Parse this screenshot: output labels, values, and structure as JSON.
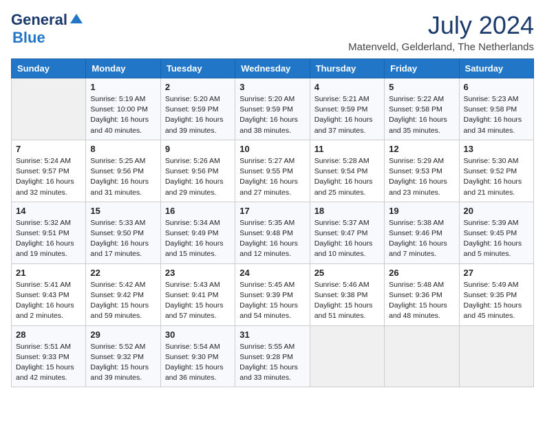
{
  "logo": {
    "line1": "General",
    "line2": "Blue"
  },
  "title": "July 2024",
  "location": "Matenveld, Gelderland, The Netherlands",
  "days_of_week": [
    "Sunday",
    "Monday",
    "Tuesday",
    "Wednesday",
    "Thursday",
    "Friday",
    "Saturday"
  ],
  "weeks": [
    [
      {
        "day": "",
        "content": ""
      },
      {
        "day": "1",
        "content": "Sunrise: 5:19 AM\nSunset: 10:00 PM\nDaylight: 16 hours\nand 40 minutes."
      },
      {
        "day": "2",
        "content": "Sunrise: 5:20 AM\nSunset: 9:59 PM\nDaylight: 16 hours\nand 39 minutes."
      },
      {
        "day": "3",
        "content": "Sunrise: 5:20 AM\nSunset: 9:59 PM\nDaylight: 16 hours\nand 38 minutes."
      },
      {
        "day": "4",
        "content": "Sunrise: 5:21 AM\nSunset: 9:59 PM\nDaylight: 16 hours\nand 37 minutes."
      },
      {
        "day": "5",
        "content": "Sunrise: 5:22 AM\nSunset: 9:58 PM\nDaylight: 16 hours\nand 35 minutes."
      },
      {
        "day": "6",
        "content": "Sunrise: 5:23 AM\nSunset: 9:58 PM\nDaylight: 16 hours\nand 34 minutes."
      }
    ],
    [
      {
        "day": "7",
        "content": "Sunrise: 5:24 AM\nSunset: 9:57 PM\nDaylight: 16 hours\nand 32 minutes."
      },
      {
        "day": "8",
        "content": "Sunrise: 5:25 AM\nSunset: 9:56 PM\nDaylight: 16 hours\nand 31 minutes."
      },
      {
        "day": "9",
        "content": "Sunrise: 5:26 AM\nSunset: 9:56 PM\nDaylight: 16 hours\nand 29 minutes."
      },
      {
        "day": "10",
        "content": "Sunrise: 5:27 AM\nSunset: 9:55 PM\nDaylight: 16 hours\nand 27 minutes."
      },
      {
        "day": "11",
        "content": "Sunrise: 5:28 AM\nSunset: 9:54 PM\nDaylight: 16 hours\nand 25 minutes."
      },
      {
        "day": "12",
        "content": "Sunrise: 5:29 AM\nSunset: 9:53 PM\nDaylight: 16 hours\nand 23 minutes."
      },
      {
        "day": "13",
        "content": "Sunrise: 5:30 AM\nSunset: 9:52 PM\nDaylight: 16 hours\nand 21 minutes."
      }
    ],
    [
      {
        "day": "14",
        "content": "Sunrise: 5:32 AM\nSunset: 9:51 PM\nDaylight: 16 hours\nand 19 minutes."
      },
      {
        "day": "15",
        "content": "Sunrise: 5:33 AM\nSunset: 9:50 PM\nDaylight: 16 hours\nand 17 minutes."
      },
      {
        "day": "16",
        "content": "Sunrise: 5:34 AM\nSunset: 9:49 PM\nDaylight: 16 hours\nand 15 minutes."
      },
      {
        "day": "17",
        "content": "Sunrise: 5:35 AM\nSunset: 9:48 PM\nDaylight: 16 hours\nand 12 minutes."
      },
      {
        "day": "18",
        "content": "Sunrise: 5:37 AM\nSunset: 9:47 PM\nDaylight: 16 hours\nand 10 minutes."
      },
      {
        "day": "19",
        "content": "Sunrise: 5:38 AM\nSunset: 9:46 PM\nDaylight: 16 hours\nand 7 minutes."
      },
      {
        "day": "20",
        "content": "Sunrise: 5:39 AM\nSunset: 9:45 PM\nDaylight: 16 hours\nand 5 minutes."
      }
    ],
    [
      {
        "day": "21",
        "content": "Sunrise: 5:41 AM\nSunset: 9:43 PM\nDaylight: 16 hours\nand 2 minutes."
      },
      {
        "day": "22",
        "content": "Sunrise: 5:42 AM\nSunset: 9:42 PM\nDaylight: 15 hours\nand 59 minutes."
      },
      {
        "day": "23",
        "content": "Sunrise: 5:43 AM\nSunset: 9:41 PM\nDaylight: 15 hours\nand 57 minutes."
      },
      {
        "day": "24",
        "content": "Sunrise: 5:45 AM\nSunset: 9:39 PM\nDaylight: 15 hours\nand 54 minutes."
      },
      {
        "day": "25",
        "content": "Sunrise: 5:46 AM\nSunset: 9:38 PM\nDaylight: 15 hours\nand 51 minutes."
      },
      {
        "day": "26",
        "content": "Sunrise: 5:48 AM\nSunset: 9:36 PM\nDaylight: 15 hours\nand 48 minutes."
      },
      {
        "day": "27",
        "content": "Sunrise: 5:49 AM\nSunset: 9:35 PM\nDaylight: 15 hours\nand 45 minutes."
      }
    ],
    [
      {
        "day": "28",
        "content": "Sunrise: 5:51 AM\nSunset: 9:33 PM\nDaylight: 15 hours\nand 42 minutes."
      },
      {
        "day": "29",
        "content": "Sunrise: 5:52 AM\nSunset: 9:32 PM\nDaylight: 15 hours\nand 39 minutes."
      },
      {
        "day": "30",
        "content": "Sunrise: 5:54 AM\nSunset: 9:30 PM\nDaylight: 15 hours\nand 36 minutes."
      },
      {
        "day": "31",
        "content": "Sunrise: 5:55 AM\nSunset: 9:28 PM\nDaylight: 15 hours\nand 33 minutes."
      },
      {
        "day": "",
        "content": ""
      },
      {
        "day": "",
        "content": ""
      },
      {
        "day": "",
        "content": ""
      }
    ]
  ]
}
